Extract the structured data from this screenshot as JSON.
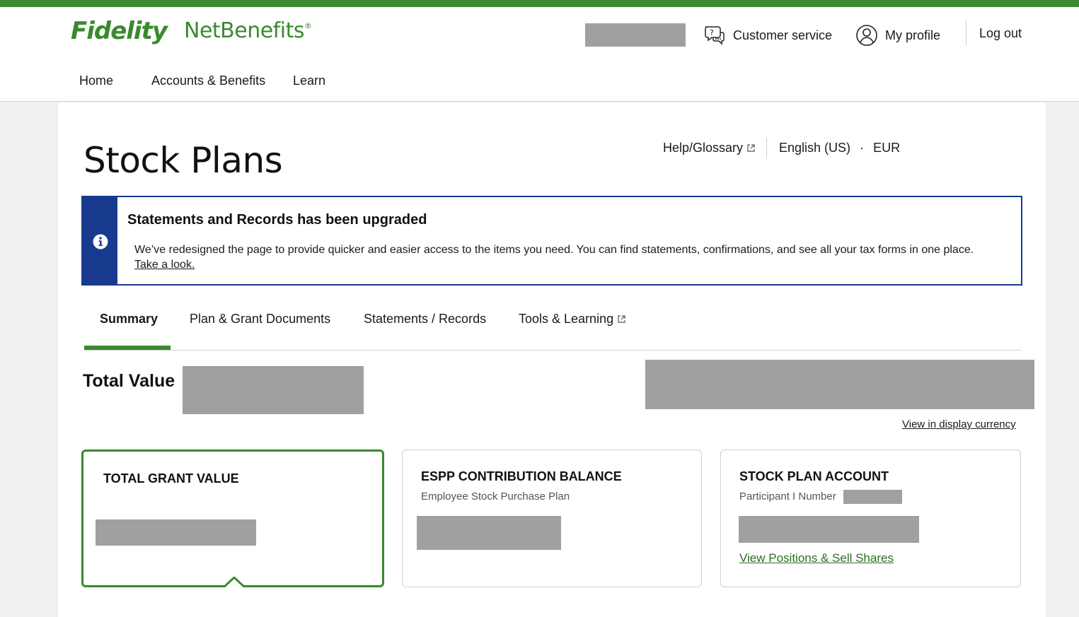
{
  "brand": {
    "logo_main": "Fidelity",
    "logo_product": "NetBenefits",
    "logo_reg": "®",
    "color_accent": "#3a8a2e",
    "color_alert": "#173a8e"
  },
  "header": {
    "customer_service": "Customer service",
    "customer_service_icon": "chat-question-icon",
    "my_profile": "My profile",
    "my_profile_icon": "user-circle-icon",
    "log_out": "Log out"
  },
  "nav": {
    "items": [
      "Home",
      "Accounts & Benefits",
      "Learn"
    ]
  },
  "page": {
    "title": "Stock Plans",
    "help_glossary": "Help/Glossary",
    "language": "English (US)",
    "separator": "·",
    "currency": "EUR"
  },
  "alert": {
    "title": "Statements and Records has been upgraded",
    "body": "We’ve redesigned the page to provide quicker and easier access to the items you need. You can find statements, confirmations, and see all your tax forms in one place.",
    "link": "Take a look.",
    "icon": "info-icon"
  },
  "tabs": [
    {
      "label": "Summary",
      "active": true
    },
    {
      "label": "Plan & Grant Documents",
      "active": false
    },
    {
      "label": "Statements / Records",
      "active": false
    },
    {
      "label": "Tools & Learning",
      "active": false,
      "external": true
    }
  ],
  "summary": {
    "total_value_label": "Total Value",
    "view_display_currency": "View in display currency"
  },
  "cards": {
    "grant": {
      "title": "TOTAL GRANT VALUE"
    },
    "espp": {
      "title": "ESPP CONTRIBUTION BALANCE",
      "subtitle": "Employee Stock Purchase Plan"
    },
    "account": {
      "title": "STOCK PLAN ACCOUNT",
      "subtitle": "Participant I Number",
      "link": "View Positions & Sell Shares"
    }
  }
}
